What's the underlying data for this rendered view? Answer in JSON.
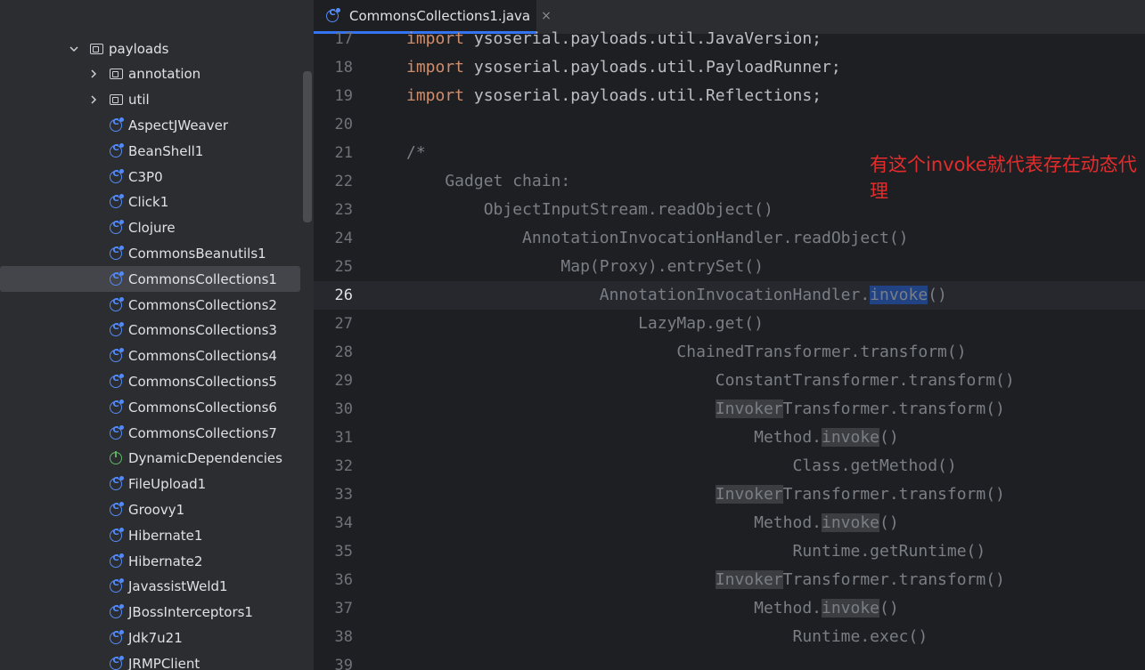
{
  "editor": {
    "tab": {
      "title": "CommonsCollections1.java",
      "close": "×"
    },
    "annotation": "有这个invoke就代表存在动态代理",
    "lines": [
      {
        "num": "17",
        "parts": [
          {
            "t": "import",
            "c": "kw"
          },
          {
            "t": " ysoserial.payloads.util.JavaVersion;"
          }
        ]
      },
      {
        "num": "18",
        "parts": [
          {
            "t": "import",
            "c": "kw"
          },
          {
            "t": " ysoserial.payloads.util.PayloadRunner;"
          }
        ]
      },
      {
        "num": "19",
        "parts": [
          {
            "t": "import",
            "c": "kw"
          },
          {
            "t": " ysoserial.payloads.util.Reflections;"
          }
        ]
      },
      {
        "num": "20",
        "parts": []
      },
      {
        "num": "21",
        "parts": [
          {
            "t": "/*",
            "c": "cm"
          }
        ]
      },
      {
        "num": "22",
        "parts": [
          {
            "t": "    Gadget chain:",
            "c": "cm"
          }
        ]
      },
      {
        "num": "23",
        "parts": [
          {
            "t": "        ObjectInputStream.readObject()",
            "c": "cm"
          }
        ]
      },
      {
        "num": "24",
        "parts": [
          {
            "t": "            AnnotationInvocationHandler.readObject()",
            "c": "cm"
          }
        ]
      },
      {
        "num": "25",
        "parts": [
          {
            "t": "                Map(Proxy).entrySet()",
            "c": "cm"
          }
        ]
      },
      {
        "num": "26",
        "current": true,
        "parts": [
          {
            "t": "                    AnnotationInvocationHandler.",
            "c": "cm"
          },
          {
            "t": "invoke",
            "c": "cm hls"
          },
          {
            "t": "()",
            "c": "cm"
          }
        ]
      },
      {
        "num": "27",
        "parts": [
          {
            "t": "                        LazyMap.get()",
            "c": "cm"
          }
        ]
      },
      {
        "num": "28",
        "parts": [
          {
            "t": "                            ChainedTransformer.transform()",
            "c": "cm"
          }
        ]
      },
      {
        "num": "29",
        "parts": [
          {
            "t": "                                ConstantTransformer.transform()",
            "c": "cm"
          }
        ]
      },
      {
        "num": "30",
        "parts": [
          {
            "t": "                                ",
            "c": "cm"
          },
          {
            "t": "Invoker",
            "c": "cm hlw"
          },
          {
            "t": "Transformer.transform()",
            "c": "cm"
          }
        ]
      },
      {
        "num": "31",
        "parts": [
          {
            "t": "                                    Method.",
            "c": "cm"
          },
          {
            "t": "invoke",
            "c": "cm hlw"
          },
          {
            "t": "()",
            "c": "cm"
          }
        ]
      },
      {
        "num": "32",
        "parts": [
          {
            "t": "                                        Class.getMethod()",
            "c": "cm"
          }
        ]
      },
      {
        "num": "33",
        "parts": [
          {
            "t": "                                ",
            "c": "cm"
          },
          {
            "t": "Invoker",
            "c": "cm hlw"
          },
          {
            "t": "Transformer.transform()",
            "c": "cm"
          }
        ]
      },
      {
        "num": "34",
        "parts": [
          {
            "t": "                                    Method.",
            "c": "cm"
          },
          {
            "t": "invoke",
            "c": "cm hlw"
          },
          {
            "t": "()",
            "c": "cm"
          }
        ]
      },
      {
        "num": "35",
        "parts": [
          {
            "t": "                                        Runtime.getRuntime()",
            "c": "cm"
          }
        ]
      },
      {
        "num": "36",
        "parts": [
          {
            "t": "                                ",
            "c": "cm"
          },
          {
            "t": "Invoker",
            "c": "cm hlw"
          },
          {
            "t": "Transformer.transform()",
            "c": "cm"
          }
        ]
      },
      {
        "num": "37",
        "parts": [
          {
            "t": "                                    Method.",
            "c": "cm"
          },
          {
            "t": "invoke",
            "c": "cm hlw"
          },
          {
            "t": "()",
            "c": "cm"
          }
        ]
      },
      {
        "num": "38",
        "parts": [
          {
            "t": "                                        Runtime.exec()",
            "c": "cm"
          }
        ]
      },
      {
        "num": "39",
        "parts": []
      }
    ]
  },
  "project_tree": {
    "items": [
      {
        "label": "payloads",
        "kind": "folder",
        "expand": "v",
        "level": 0
      },
      {
        "label": "annotation",
        "kind": "folder",
        "expand": ">",
        "level": 1
      },
      {
        "label": "util",
        "kind": "folder",
        "expand": ">",
        "level": 1
      },
      {
        "label": "AspectJWeaver",
        "kind": "class",
        "level": 1
      },
      {
        "label": "BeanShell1",
        "kind": "class",
        "level": 1
      },
      {
        "label": "C3P0",
        "kind": "class",
        "level": 1
      },
      {
        "label": "Click1",
        "kind": "class",
        "level": 1
      },
      {
        "label": "Clojure",
        "kind": "class",
        "level": 1
      },
      {
        "label": "CommonsBeanutils1",
        "kind": "class",
        "level": 1
      },
      {
        "label": "CommonsCollections1",
        "kind": "class",
        "level": 1,
        "selected": true
      },
      {
        "label": "CommonsCollections2",
        "kind": "class",
        "level": 1
      },
      {
        "label": "CommonsCollections3",
        "kind": "class",
        "level": 1
      },
      {
        "label": "CommonsCollections4",
        "kind": "class",
        "level": 1
      },
      {
        "label": "CommonsCollections5",
        "kind": "class",
        "level": 1
      },
      {
        "label": "CommonsCollections6",
        "kind": "class",
        "level": 1
      },
      {
        "label": "CommonsCollections7",
        "kind": "class",
        "level": 1
      },
      {
        "label": "DynamicDependencies",
        "kind": "interface",
        "level": 1
      },
      {
        "label": "FileUpload1",
        "kind": "class",
        "level": 1
      },
      {
        "label": "Groovy1",
        "kind": "class",
        "level": 1
      },
      {
        "label": "Hibernate1",
        "kind": "class",
        "level": 1
      },
      {
        "label": "Hibernate2",
        "kind": "class",
        "level": 1
      },
      {
        "label": "JavassistWeld1",
        "kind": "class",
        "level": 1
      },
      {
        "label": "JBossInterceptors1",
        "kind": "class",
        "level": 1
      },
      {
        "label": "Jdk7u21",
        "kind": "class",
        "level": 1
      },
      {
        "label": "JRMPClient",
        "kind": "class",
        "level": 1
      }
    ]
  }
}
